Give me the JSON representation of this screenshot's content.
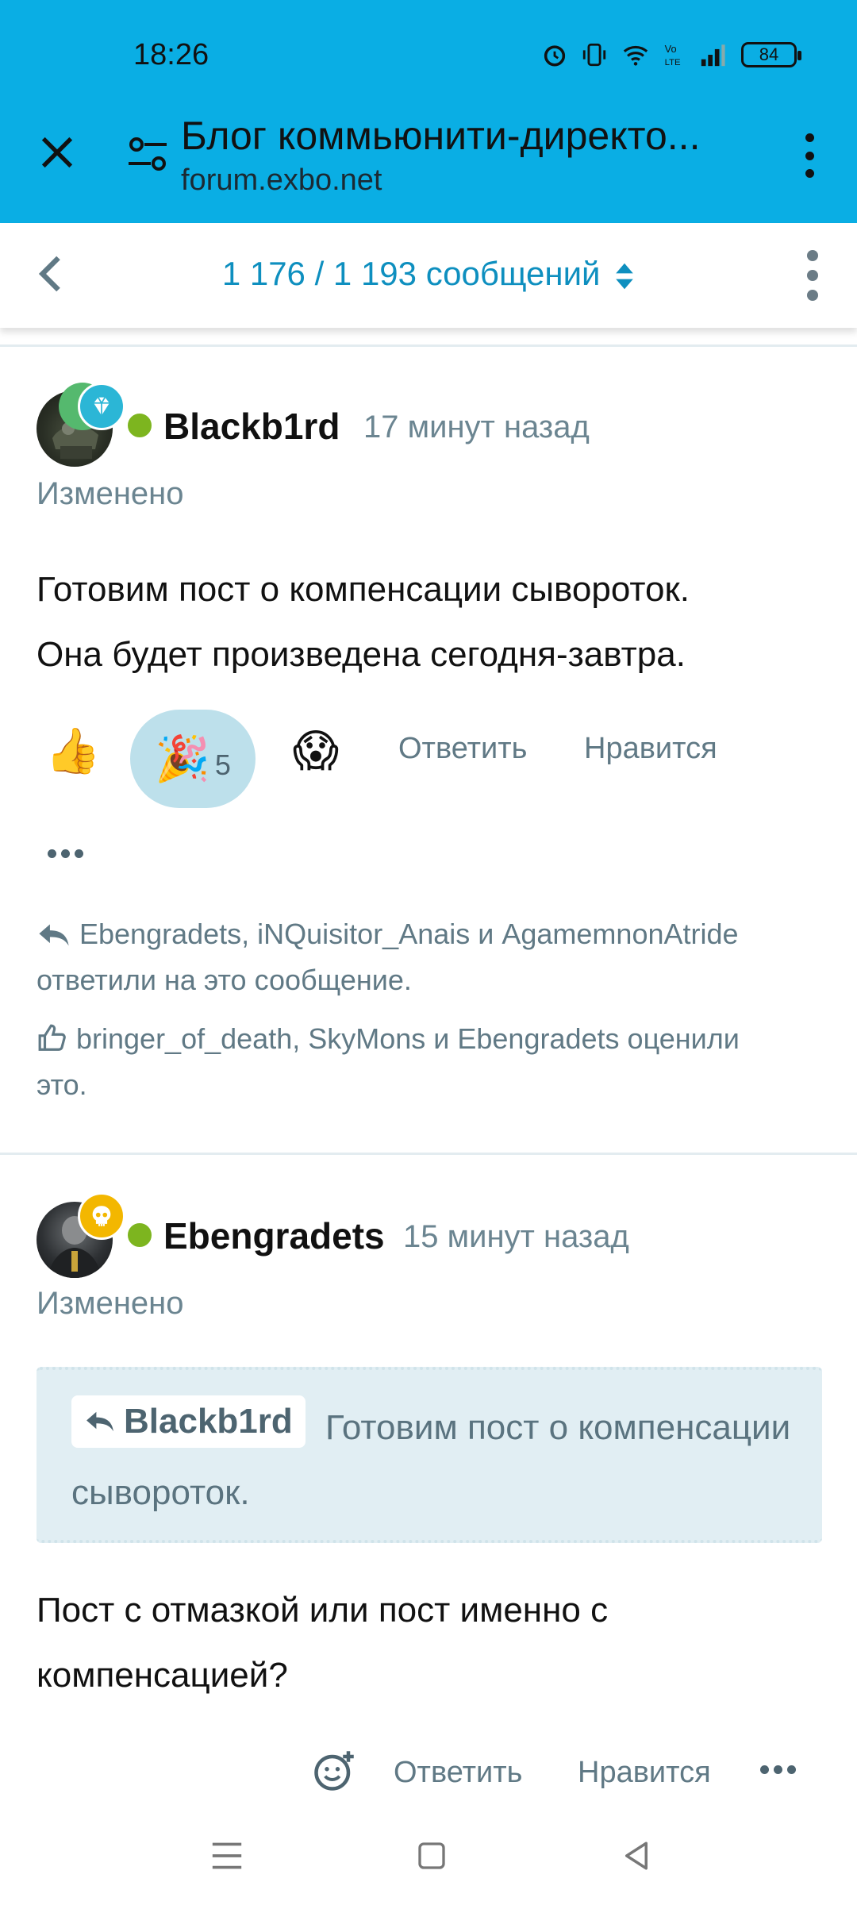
{
  "status_bar": {
    "time": "18:26",
    "battery": "84"
  },
  "browser": {
    "tab_title": "Блог коммьюнити-директо...",
    "url": "forum.exbo.net"
  },
  "topic_bar": {
    "progress": "1 176 / 1 193 сообщений"
  },
  "posts": [
    {
      "username": "Blackb1rd",
      "time_ago": "17 минут назад",
      "edited": "Изменено",
      "text_line1": "Готовим пост о компенсации сывороток.",
      "text_line2": "Она будет произведена сегодня-завтра.",
      "reactions": [
        {
          "emoji": "👍",
          "count": ""
        },
        {
          "emoji": "🎉",
          "count": "5"
        },
        {
          "emoji": "😱",
          "count": ""
        }
      ],
      "reply_label": "Ответить",
      "like_label": "Нравится",
      "replied_users": "Ebengradets, iNQuisitor_Anais и AgamemnonAtride",
      "replied_suffix": "ответили на это сообщение.",
      "liked_users": "bringer_of_death, SkyMons и Ebengradets",
      "liked_suffix": "оценили",
      "liked_suffix2": "это."
    },
    {
      "username": "Ebengradets",
      "time_ago": "15 минут назад",
      "edited": "Изменено",
      "quote_author": "Blackb1rd",
      "quote_text": "Готовим пост о компенсации сывороток.",
      "text_line1": "Пост с отмазкой или пост именно с",
      "text_line2": "компенсацией?",
      "reply_label": "Ответить",
      "like_label": "Нравится"
    }
  ],
  "colors": {
    "accent": "#0aaee4",
    "link": "#0e8fbf",
    "online": "#7db51f",
    "muted": "#607985"
  }
}
